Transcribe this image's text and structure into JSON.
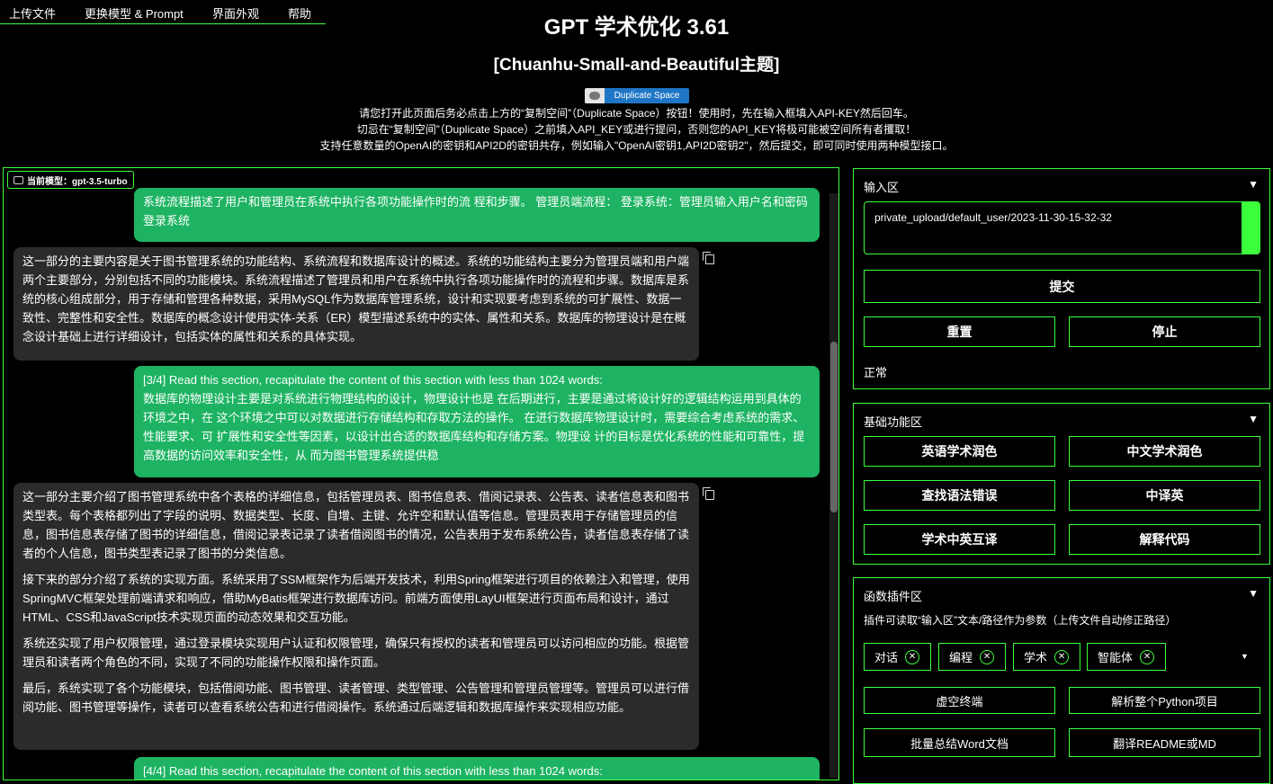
{
  "menu": [
    "上传文件",
    "更换模型 & Prompt",
    "界面外观",
    "帮助"
  ],
  "header": {
    "title": "GPT 学术优化 3.61",
    "subtitle": "[Chuanhu-Small-and-Beautiful主题]",
    "badge": "Duplicate Space",
    "notice": [
      "请您打开此页面后务必点击上方的“复制空间”（Duplicate Space）按钮！使用时，先在输入框填入API-KEY然后回车。",
      "切忌在“复制空间”（Duplicate Space）之前填入API_KEY或进行提问，否则您的API_KEY将极可能被空间所有者攫取！",
      "支持任意数量的OpenAI的密钥和API2D的密钥共存，例如输入\"OpenAI密钥1,API2D密钥2\"，然后提交，即可同时使用两种模型接口。"
    ]
  },
  "chat": {
    "model_label": "当前模型：gpt-3.5-turbo",
    "messages": [
      {
        "role": "user",
        "text": "系统流程描述了用户和管理员在系统中执行各项功能操作时的流 程和步骤。 管理员端流程： 登录系统：管理员输入用户名和密码登录系统"
      },
      {
        "role": "bot",
        "paras": [
          "这一部分的主要内容是关于图书管理系统的功能结构、系统流程和数据库设计的概述。系统的功能结构主要分为管理员端和用户端两个主要部分，分别包括不同的功能模块。系统流程描述了管理员和用户在系统中执行各项功能操作时的流程和步骤。数据库是系统的核心组成部分，用于存储和管理各种数据，采用MySQL作为数据库管理系统，设计和实现要考虑到系统的可扩展性、数据一致性、完整性和安全性。数据库的概念设计使用实体-关系（ER）模型描述系统中的实体、属性和关系。数据库的物理设计是在概念设计基础上进行详细设计，包括实体的属性和关系的具体实现。"
        ]
      },
      {
        "role": "user",
        "text": "[3/4] Read this section, recapitulate the content of this section with less than 1024 words:\n数据库的物理设计主要是对系统进行物理结构的设计，物理设计也是 在后期进行，主要是通过将设计好的逻辑结构运用到具体的环境之中，在 这个环境之中可以对数据进行存储结构和存取方法的操作。 在进行数据库物理设计时，需要综合考虑系统的需求、性能要求、可 扩展性和安全性等因素，以设计出合适的数据库结构和存储方案。物理设 计的目标是优化系统的性能和可靠性，提高数据的访问效率和安全性，从 而为图书管理系统提供稳"
      },
      {
        "role": "bot",
        "paras": [
          "这一部分主要介绍了图书管理系统中各个表格的详细信息，包括管理员表、图书信息表、借阅记录表、公告表、读者信息表和图书类型表。每个表格都列出了字段的说明、数据类型、长度、自增、主键、允许空和默认值等信息。管理员表用于存储管理员的信息，图书信息表存储了图书的详细信息，借阅记录表记录了读者借阅图书的情况，公告表用于发布系统公告，读者信息表存储了读者的个人信息，图书类型表记录了图书的分类信息。",
          "接下来的部分介绍了系统的实现方面。系统采用了SSM框架作为后端开发技术，利用Spring框架进行项目的依赖注入和管理，使用SpringMVC框架处理前端请求和响应，借助MyBatis框架进行数据库访问。前端方面使用LayUI框架进行页面布局和设计，通过HTML、CSS和JavaScript技术实现页面的动态效果和交互功能。",
          "系统还实现了用户权限管理，通过登录模块实现用户认证和权限管理，确保只有授权的读者和管理员可以访问相应的功能。根据管理员和读者两个角色的不同，实现了不同的功能操作权限和操作页面。",
          "最后，系统实现了各个功能模块，包括借阅功能、图书管理、读者管理、类型管理、公告管理和管理员管理等。管理员可以进行借阅功能、图书管理等操作，读者可以查看系统公告和进行借阅操作。系统通过后端逻辑和数据库操作来实现相应功能。"
        ]
      },
      {
        "role": "user",
        "text": "[4/4] Read this section, recapitulate the content of this section with less than 1024 words:"
      }
    ]
  },
  "input_panel": {
    "title": "输入区",
    "collapse_icon": "▼",
    "value": "private_upload/default_user/2023-11-30-15-32-32",
    "submit": "提交",
    "reset": "重置",
    "stop": "停止",
    "status": "正常"
  },
  "basic_panel": {
    "title": "基础功能区",
    "collapse_icon": "▼",
    "buttons": [
      "英语学术润色",
      "中文学术润色",
      "查找语法错误",
      "中译英",
      "学术中英互译",
      "解释代码"
    ]
  },
  "plugin_panel": {
    "title": "函数插件区",
    "collapse_icon": "▼",
    "hint": "插件可读取“输入区”文本/路径作为参数（上传文件自动修正路径）",
    "chips": [
      "对话",
      "编程",
      "学术",
      "智能体"
    ],
    "chip_close": "✕",
    "dropdown_caret": "▼",
    "buttons": [
      "虚空终端",
      "解析整个Python项目",
      "批量总结Word文档",
      "翻译README或MD"
    ]
  }
}
